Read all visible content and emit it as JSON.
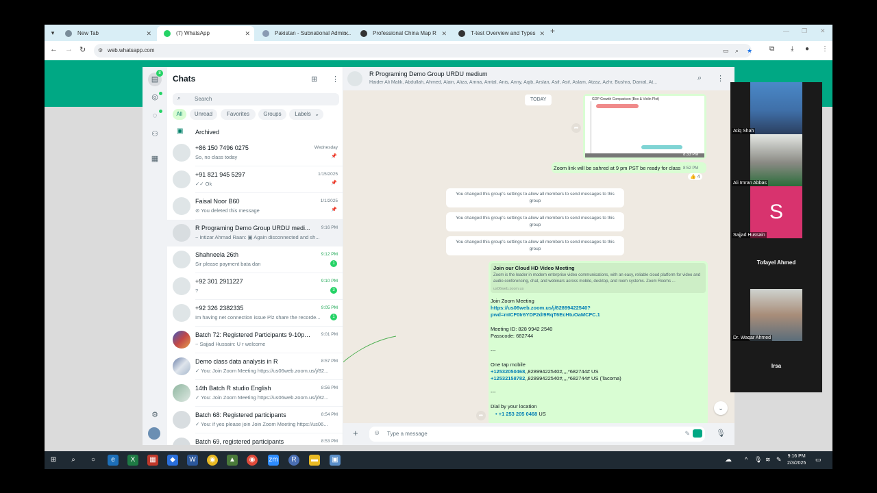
{
  "browser": {
    "tabs": [
      {
        "label": "New Tab"
      },
      {
        "label": "(7) WhatsApp"
      },
      {
        "label": "Pakistan - Subnational Admin..."
      },
      {
        "label": "Professional China Map R"
      },
      {
        "label": "T-test Overview and Types"
      }
    ],
    "url": "web.whatsapp.com"
  },
  "rail": {
    "chats_badge": "8"
  },
  "chatlist": {
    "title": "Chats",
    "search_placeholder": "Search",
    "filters": [
      "All",
      "Unread",
      "Favorites",
      "Groups",
      "Labels"
    ],
    "archived": "Archived",
    "rows": [
      {
        "name": "+86 150 7496 0275",
        "time": "Wednesday",
        "msg": "So, no class today",
        "pinned": true
      },
      {
        "name": "+91 821 945 5297",
        "time": "1/15/2025",
        "msg": "✓✓ Ok",
        "pinned": true
      },
      {
        "name": "Faisal Noor B60",
        "time": "1/1/2025",
        "msg": "⊘ You deleted this message",
        "pinned": true
      },
      {
        "name": "R Programing Demo Group URDU medi...",
        "time": "9:16 PM",
        "msg": "~ Intizar Ahmad Raan: ▣ Again disconnected and sh..."
      },
      {
        "name": "Shahneela 26th",
        "time": "9:12 PM",
        "msg": "Sir please payment bata dan",
        "badge": "1"
      },
      {
        "name": "+92 301 2911227",
        "time": "9:10 PM",
        "msg": "?",
        "badge": "3"
      },
      {
        "name": "+92 326 2382335",
        "time": "9:05 PM",
        "msg": "Im having net connection issue Plz share the recorde...",
        "badge": "1"
      },
      {
        "name": "Batch 72: Registered Participants 9-10pm ...",
        "time": "9:01 PM",
        "msg": "~ Sajjad Hussain: U r welcome"
      },
      {
        "name": "Demo class data analysis in R",
        "time": "8:57 PM",
        "msg": "✓ You: Join Zoom Meeting https://us06web.zoom.us/j/82..."
      },
      {
        "name": "14th Batch R studio English",
        "time": "8:56 PM",
        "msg": "✓ You: Join Zoom Meeting https://us06web.zoom.us/j/82..."
      },
      {
        "name": "Batch 68: Registered participants",
        "time": "8:54 PM",
        "msg": "✓ You: if yes please join Join Zoom Meeting https://us06..."
      },
      {
        "name": "Batch 69, registered participants",
        "time": "8:53 PM",
        "msg": ""
      }
    ]
  },
  "conversation": {
    "title": "R Programing Demo Group URDU medium",
    "members": "Haider Ali Malik, Abdullah, Ahmed, Alain, Aliza, Amna, Amtal, Anis, Anny, Aqib, Arslan, Asif, Asif, Aslam, Atzaz, Azhr, Bushra, Danial, At...",
    "date_pill": "TODAY",
    "image_time": "8:33 PM",
    "chart_thumb_title": "GDP Growth Comparison (Box & Violin Plot)",
    "zoom_note": "Zoom link will be sahred at 9 pm PST be ready for class",
    "zoom_note_time": "8:52 PM",
    "reaction": "👍 4",
    "system_msg": "You changed this group's settings to allow all members to send messages to this group",
    "card": {
      "preview_title": "Join our Cloud HD Video Meeting",
      "preview_desc": "Zoom is the leader in modern enterprise video communications, with an easy, reliable cloud platform for video and audio conferencing, chat, and webinars across mobile, desktop, and room systems. Zoom Rooms ...",
      "preview_url": "us06web.zoom.us",
      "join": "Join Zoom Meeting",
      "link1": "https://us06web.zoom.us/j/82899422540?",
      "link2": "pwd=mICF0Ir6YDF2dI9RqT6EcHtuOaMCFC.1",
      "meeting_id": "Meeting ID: 828 9942 2540",
      "passcode": "Passcode: 682744",
      "sep": "---",
      "one_tap": "One tap mobile",
      "tap1_num": "+12532050468",
      "tap1_rest": ",,82899422540#,,,,*682744# US",
      "tap2_num": "+12532158782",
      "tap2_rest": ",,82899422540#,,,,*682744# US (Tacoma)",
      "dial": "Dial by your location",
      "dial1_num": "• +1 253 205 0468",
      "dial1_rest": " US"
    },
    "composer_placeholder": "Type a message"
  },
  "zoom": {
    "participants": [
      {
        "name": "Atiq Shah"
      },
      {
        "name": "Ali Imran Abbas"
      },
      {
        "name": "Sajjad Hussain",
        "initial": "S"
      },
      {
        "name": "Tofayel Ahmed"
      },
      {
        "name": "Dr. Waqar Ahmed"
      },
      {
        "name": "Irsa"
      }
    ]
  },
  "taskbar": {
    "time": "9:16 PM",
    "date": "2/3/2025"
  }
}
